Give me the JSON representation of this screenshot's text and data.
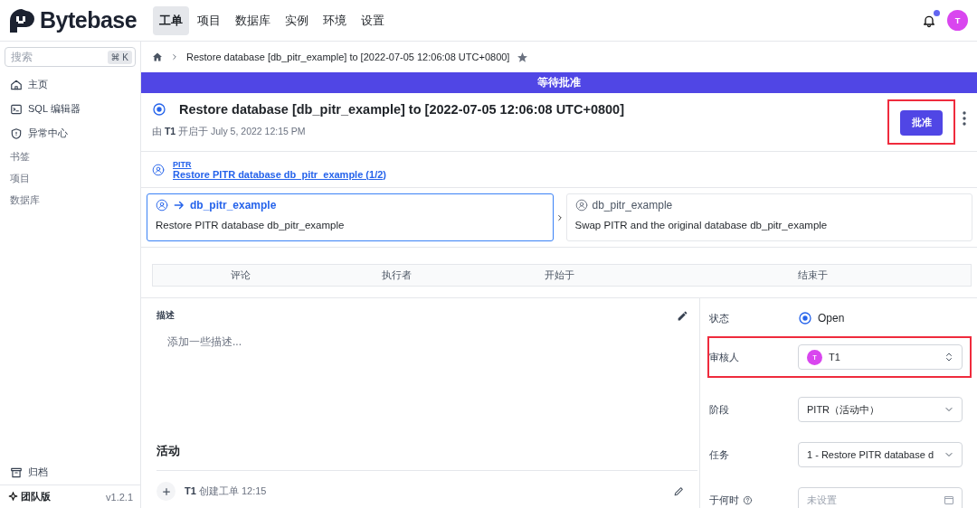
{
  "app": {
    "logo": "Bytebase"
  },
  "nav": [
    {
      "label": "工单",
      "selected": true
    },
    {
      "label": "项目",
      "selected": false
    },
    {
      "label": "数据库",
      "selected": false
    },
    {
      "label": "实例",
      "selected": false
    },
    {
      "label": "环境",
      "selected": false
    },
    {
      "label": "设置",
      "selected": false
    }
  ],
  "header": {
    "avatar": "T",
    "unread": true
  },
  "sidebar": {
    "search": {
      "placeholder": "搜索",
      "shortcut": "⌘ K"
    },
    "items": [
      {
        "label": "主页",
        "kind": "link"
      },
      {
        "label": "SQL 编辑器",
        "kind": "link"
      },
      {
        "label": "异常中心",
        "kind": "link"
      },
      {
        "label": "书签",
        "kind": "section"
      },
      {
        "label": "项目",
        "kind": "section"
      },
      {
        "label": "数据库",
        "kind": "section"
      }
    ],
    "archive": "归档",
    "edition": "团队版",
    "version": "v1.2.1"
  },
  "breadcrumb": {
    "title": "Restore database [db_pitr_example] to [2022-07-05 12:06:08 UTC+0800]"
  },
  "banner": "等待批准",
  "issue": {
    "title": "Restore database [db_pitr_example] to [2022-07-05 12:06:08 UTC+0800]",
    "by": "由",
    "creator": "T1",
    "created": "开启于 July 5, 2022 12:15 PM",
    "approve": {
      "label": "批准",
      "highlighted": true
    }
  },
  "pipeline": {
    "name": "PITR",
    "task_link": "Restore PITR database db_pitr_example (1/2)"
  },
  "stages": [
    {
      "name": "db_pitr_example",
      "description": "Restore PITR database db_pitr_example",
      "selected": true
    },
    {
      "name": "db_pitr_example",
      "description": "Swap PITR and the original database db_pitr_example",
      "selected": false
    }
  ],
  "task_table": {
    "columns": [
      "评论",
      "执行者",
      "开始于",
      "结束于"
    ]
  },
  "description": {
    "label": "描述",
    "placeholder": "添加一些描述..."
  },
  "activity": {
    "title": "活动",
    "entries": [
      {
        "user": "T1",
        "action": "创建工单 12:15"
      }
    ]
  },
  "details": [
    {
      "kind": "status",
      "label": "状态",
      "value": "Open"
    },
    {
      "kind": "user",
      "label": "审核人",
      "avatar": "T",
      "value": "T1",
      "highlighted": true
    },
    {
      "kind": "select",
      "label": "阶段",
      "value": "PITR（活动中）"
    },
    {
      "kind": "select",
      "label": "任务",
      "value": "1 - Restore PITR database d"
    },
    {
      "kind": "date",
      "label": "于何时",
      "placeholder": "未设置"
    }
  ]
}
